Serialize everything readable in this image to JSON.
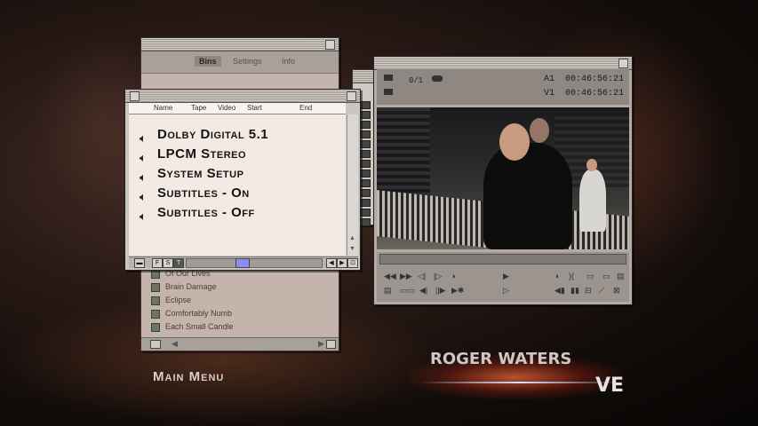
{
  "bins_window": {
    "tabs": [
      "Bins",
      "Settings",
      "Info"
    ],
    "active_tab": "Bins",
    "items": [
      "Of Our Lives",
      "Brain Damage",
      "Eclipse",
      "Comfortably Numb",
      "Each Small Candle"
    ]
  },
  "menu_window": {
    "columns": [
      "Name",
      "Tape",
      "Video",
      "Start",
      "End"
    ],
    "items": [
      {
        "label": "Dolby Digital 5.1",
        "icon": "speaker-icon"
      },
      {
        "label": "LPCM Stereo",
        "icon": "speaker-icon"
      },
      {
        "label": "System Setup",
        "icon": "speaker-icon"
      },
      {
        "label": "Subtitles - On",
        "icon": "speaker-icon"
      },
      {
        "label": "Subtitles - Off",
        "icon": "speaker-icon"
      }
    ],
    "bottom_buttons": [
      "F",
      "S",
      "T"
    ]
  },
  "player": {
    "counter": "0/1",
    "timecodes": [
      {
        "track": "A1",
        "time": "00:46:56:21"
      },
      {
        "track": "V1",
        "time": "00:46:56:21"
      }
    ]
  },
  "main_menu_label": "Main Menu",
  "logo": {
    "line1": "ROGER WATERS",
    "line2": "VE"
  }
}
